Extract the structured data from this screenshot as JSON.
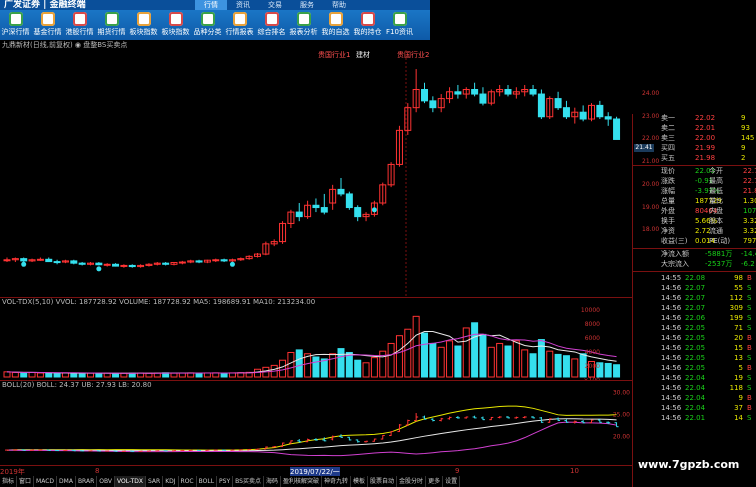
{
  "app": {
    "logo": "广发证券",
    "title": "金融终端"
  },
  "menu_tabs": [
    "行情",
    "资讯",
    "交易",
    "服务",
    "帮助"
  ],
  "toolbar": [
    "沪深行情",
    "基金行情",
    "港股行情",
    "期货行情",
    "板块指数",
    "板块指数",
    "品种分类",
    "行情报表",
    "综合排名",
    "报表分析",
    "我的自选",
    "我的持仓",
    "F10资讯"
  ],
  "chart_header": "九鼎新材(日线,前复权)  ◉ 盘整BS买卖点",
  "price_annotations": [
    "贵国行业1",
    "建材",
    "贵国行业2"
  ],
  "indicators": {
    "vol": "VOL-TDX(5,10)  VVOL: 187728.92  VOLUME: 187728.92  MA5: 198689.91  MA10: 213234.00",
    "boll": "BOLL(20)  BOLL: 24.37  UB: 27.93  LB: 20.80"
  },
  "price_axis": [
    "24.00",
    "23.00",
    "22.00",
    "21.00",
    "20.00",
    "19.00",
    "18.00"
  ],
  "vol_axis": [
    "10000",
    "8000",
    "6000",
    "4000",
    "2000",
    "×100"
  ],
  "boll_axis": [
    "30.00",
    "25.00",
    "20.00"
  ],
  "current_price_tag": "21.41",
  "dates": [
    {
      "label": "2019年",
      "pos": 0
    },
    {
      "label": "8",
      "pos": 95
    },
    {
      "label": "2019/07/22/一",
      "pos": 290
    },
    {
      "label": "9",
      "pos": 455
    },
    {
      "label": "10",
      "pos": 570
    }
  ],
  "bottom_tabs": [
    "指标",
    "窗口",
    "MACD",
    "DMA",
    "BRAR",
    "OBV",
    "VOL-TDX",
    "SAR",
    "KDJ",
    "ROC",
    "BOLL",
    "PSY",
    "BS买卖点",
    "海码",
    "盈利核解突破",
    "神奇九转",
    "模板",
    "股票自动",
    "金股分时",
    "更多",
    "设置"
  ],
  "orderbook": {
    "sell": [
      {
        "label": "卖一",
        "price": "22.02",
        "vol": "9"
      },
      {
        "label": "卖二",
        "price": "22.01",
        "vol": "93"
      },
      {
        "label": "卖三",
        "price": "22.00",
        "vol": "145"
      }
    ],
    "buy": [
      {
        "label": "买四",
        "price": "21.99",
        "vol": "9"
      },
      {
        "label": "买五",
        "price": "21.98",
        "vol": "2"
      }
    ]
  },
  "stats": [
    {
      "l": "现价",
      "v": "22.03",
      "l2": "今开",
      "v2": "22.76"
    },
    {
      "l": "涨跌",
      "v": "-0.91",
      "l2": "最高",
      "v2": "22.76"
    },
    {
      "l": "涨幅",
      "v": "-3.97%",
      "l2": "最低",
      "v2": "21.80"
    },
    {
      "l": "总量",
      "v": "187729",
      "l2": "量比",
      "v2": "1.30"
    },
    {
      "l": "外盘",
      "v": "80464",
      "l2": "内盘",
      "v2": "107265"
    },
    {
      "l": "换手",
      "v": "5.66%",
      "l2": "股本",
      "v2": "3.32亿"
    },
    {
      "l": "净资",
      "v": "2.72",
      "l2": "流通",
      "v2": "3.32亿"
    },
    {
      "l": "收益(三)",
      "v": "0.014",
      "l2": "PE(动)",
      "v2": "797.2"
    }
  ],
  "flows": [
    {
      "l": "净流入额",
      "v": "-5881万",
      "v2": "-14.4"
    },
    {
      "l": "大宗流入",
      "v": "-2537万",
      "v2": "-6.2"
    }
  ],
  "ticks": [
    {
      "t": "14:55",
      "p": "22.08",
      "v": "98",
      "f": "B"
    },
    {
      "t": "14:56",
      "p": "22.07",
      "v": "55",
      "f": "S"
    },
    {
      "t": "14:56",
      "p": "22.07",
      "v": "112",
      "f": "S"
    },
    {
      "t": "14:56",
      "p": "22.07",
      "v": "309",
      "f": "S"
    },
    {
      "t": "14:56",
      "p": "22.06",
      "v": "199",
      "f": "S"
    },
    {
      "t": "14:56",
      "p": "22.05",
      "v": "71",
      "f": "S"
    },
    {
      "t": "14:56",
      "p": "22.05",
      "v": "20",
      "f": "B"
    },
    {
      "t": "14:56",
      "p": "22.05",
      "v": "15",
      "f": "B"
    },
    {
      "t": "14:56",
      "p": "22.05",
      "v": "13",
      "f": "S"
    },
    {
      "t": "14:56",
      "p": "22.05",
      "v": "5",
      "f": "B"
    },
    {
      "t": "14:56",
      "p": "22.04",
      "v": "19",
      "f": "S"
    },
    {
      "t": "14:56",
      "p": "22.04",
      "v": "118",
      "f": "S"
    },
    {
      "t": "14:56",
      "p": "22.04",
      "v": "9",
      "f": "B"
    },
    {
      "t": "14:56",
      "p": "22.04",
      "v": "37",
      "f": "B"
    },
    {
      "t": "14:56",
      "p": "22.01",
      "v": "14",
      "f": "S"
    }
  ],
  "watermark": "www.7gpzb.com",
  "colors": {
    "up": "#ff3333",
    "down": "#35e0ee",
    "bg": "#000000",
    "grid": "#7a1010"
  },
  "chart_data": {
    "type": "candlestick",
    "candles": [
      [
        16.7,
        16.8,
        16.6,
        16.7
      ],
      [
        16.7,
        16.8,
        16.6,
        16.75
      ],
      [
        16.75,
        16.8,
        16.6,
        16.65
      ],
      [
        16.65,
        16.75,
        16.6,
        16.7
      ],
      [
        16.7,
        16.8,
        16.65,
        16.72
      ],
      [
        16.72,
        16.8,
        16.6,
        16.62
      ],
      [
        16.62,
        16.7,
        16.5,
        16.6
      ],
      [
        16.6,
        16.7,
        16.55,
        16.65
      ],
      [
        16.65,
        16.7,
        16.5,
        16.55
      ],
      [
        16.55,
        16.6,
        16.45,
        16.5
      ],
      [
        16.5,
        16.6,
        16.45,
        16.55
      ],
      [
        16.55,
        16.6,
        16.45,
        16.48
      ],
      [
        16.48,
        16.55,
        16.4,
        16.5
      ],
      [
        16.5,
        16.55,
        16.4,
        16.42
      ],
      [
        16.42,
        16.5,
        16.35,
        16.45
      ],
      [
        16.45,
        16.5,
        16.35,
        16.4
      ],
      [
        16.4,
        16.5,
        16.35,
        16.45
      ],
      [
        16.45,
        16.55,
        16.4,
        16.5
      ],
      [
        16.5,
        16.6,
        16.45,
        16.55
      ],
      [
        16.55,
        16.6,
        16.45,
        16.5
      ],
      [
        16.5,
        16.6,
        16.45,
        16.58
      ],
      [
        16.58,
        16.65,
        16.5,
        16.6
      ],
      [
        16.6,
        16.7,
        16.55,
        16.65
      ],
      [
        16.65,
        16.7,
        16.55,
        16.6
      ],
      [
        16.6,
        16.7,
        16.55,
        16.68
      ],
      [
        16.68,
        16.75,
        16.6,
        16.7
      ],
      [
        16.7,
        16.75,
        16.6,
        16.65
      ],
      [
        16.65,
        16.75,
        16.6,
        16.7
      ],
      [
        16.7,
        16.8,
        16.65,
        16.75
      ],
      [
        16.75,
        16.9,
        16.7,
        16.85
      ],
      [
        16.85,
        17.0,
        16.8,
        16.95
      ],
      [
        16.95,
        17.5,
        16.9,
        17.4
      ],
      [
        17.4,
        17.6,
        17.3,
        17.5
      ],
      [
        17.5,
        18.4,
        17.4,
        18.3
      ],
      [
        18.3,
        18.9,
        18.1,
        18.8
      ],
      [
        18.8,
        19.2,
        18.4,
        18.6
      ],
      [
        18.6,
        19.3,
        18.5,
        19.1
      ],
      [
        19.1,
        19.4,
        18.8,
        19.0
      ],
      [
        19.0,
        19.6,
        18.7,
        18.8
      ],
      [
        19.2,
        20.0,
        18.9,
        19.8
      ],
      [
        19.8,
        20.3,
        19.5,
        19.6
      ],
      [
        19.6,
        19.7,
        18.9,
        19.0
      ],
      [
        19.0,
        19.1,
        18.4,
        18.6
      ],
      [
        18.6,
        18.8,
        18.4,
        18.7
      ],
      [
        18.7,
        19.3,
        18.6,
        19.2
      ],
      [
        19.2,
        20.1,
        19.1,
        20.0
      ],
      [
        20.0,
        21.0,
        19.9,
        20.9
      ],
      [
        20.9,
        22.6,
        20.8,
        22.4
      ],
      [
        22.4,
        23.6,
        22.2,
        23.4
      ],
      [
        23.4,
        25.1,
        23.2,
        24.2
      ],
      [
        24.2,
        24.5,
        23.6,
        23.7
      ],
      [
        23.7,
        23.9,
        23.2,
        23.4
      ],
      [
        23.4,
        24.0,
        23.2,
        23.8
      ],
      [
        23.8,
        24.3,
        23.6,
        24.1
      ],
      [
        24.1,
        24.4,
        23.8,
        24.0
      ],
      [
        24.0,
        24.3,
        23.8,
        24.2
      ],
      [
        24.2,
        24.5,
        23.9,
        24.0
      ],
      [
        24.0,
        24.3,
        23.5,
        23.6
      ],
      [
        23.6,
        24.2,
        23.5,
        24.1
      ],
      [
        24.1,
        24.4,
        23.9,
        24.2
      ],
      [
        24.2,
        24.4,
        23.9,
        24.0
      ],
      [
        24.0,
        24.3,
        23.8,
        24.1
      ],
      [
        24.1,
        24.4,
        23.9,
        24.2
      ],
      [
        24.2,
        24.4,
        23.9,
        24.0
      ],
      [
        24.0,
        24.2,
        22.9,
        23.0
      ],
      [
        23.0,
        23.9,
        22.9,
        23.8
      ],
      [
        23.8,
        24.1,
        23.3,
        23.4
      ],
      [
        23.4,
        23.7,
        22.9,
        23.0
      ],
      [
        23.0,
        23.4,
        22.7,
        23.2
      ],
      [
        23.2,
        23.5,
        22.8,
        22.9
      ],
      [
        22.9,
        23.6,
        22.8,
        23.5
      ],
      [
        23.5,
        23.7,
        22.9,
        23.0
      ],
      [
        23.0,
        23.2,
        22.6,
        22.9
      ],
      [
        22.9,
        23.0,
        22.0,
        22.0
      ]
    ],
    "volume": [
      800,
      700,
      650,
      700,
      620,
      600,
      580,
      640,
      600,
      560,
      590,
      570,
      610,
      560,
      580,
      600,
      620,
      590,
      610,
      650,
      600,
      620,
      640,
      600,
      630,
      650,
      600,
      640,
      680,
      720,
      1200,
      1500,
      1800,
      2600,
      3800,
      4200,
      3600,
      3100,
      2800,
      3600,
      4400,
      3800,
      2600,
      2200,
      3000,
      4000,
      5200,
      6400,
      7400,
      9400,
      6800,
      5200,
      4600,
      5600,
      4800,
      7600,
      8400,
      6600,
      4600,
      5200,
      4800,
      5600,
      4200,
      3600,
      5800,
      4000,
      3500,
      3300,
      2800,
      3600,
      2400,
      2200,
      2100,
      1900
    ],
    "ylim": [
      15.5,
      25.5
    ]
  }
}
